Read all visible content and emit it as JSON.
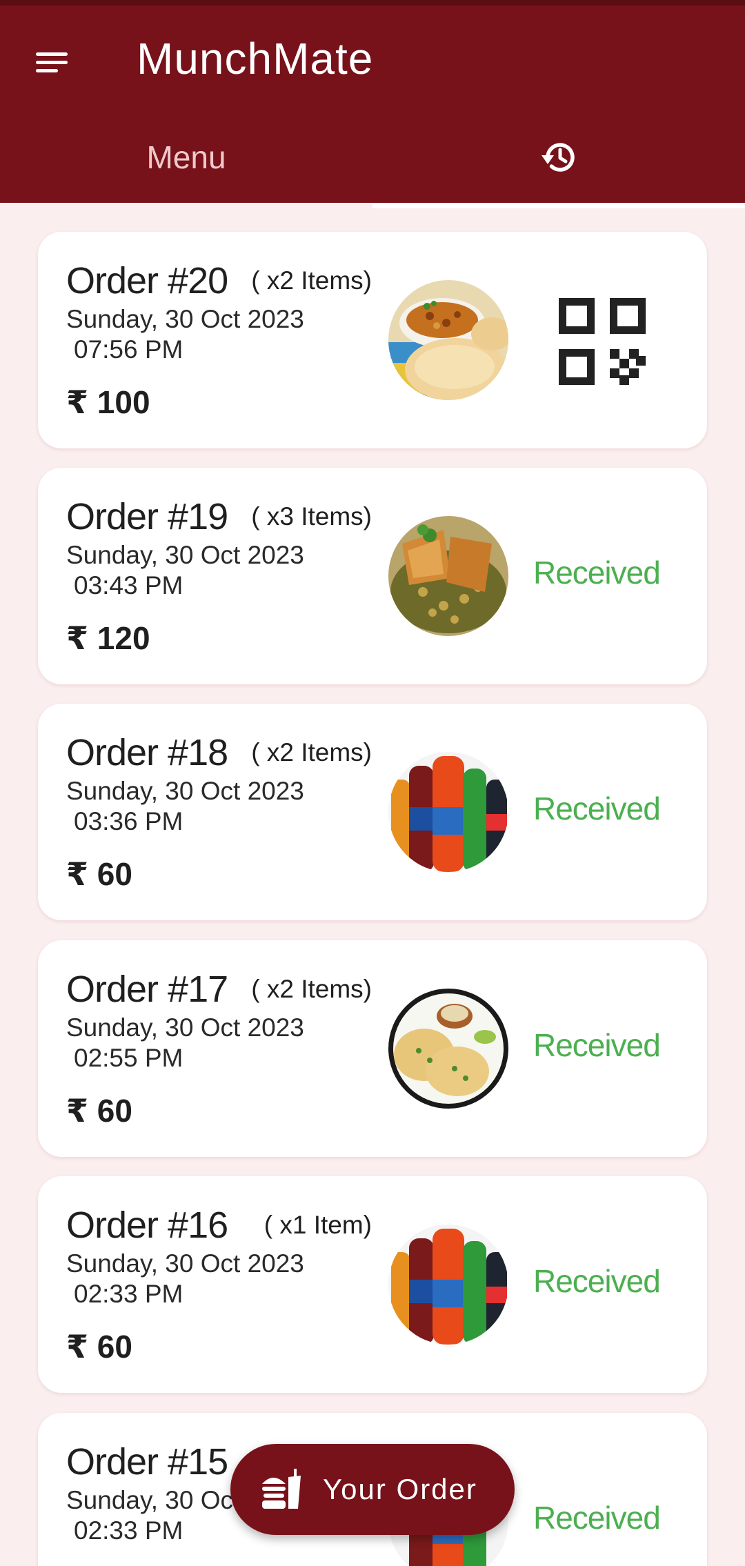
{
  "app": {
    "title": "MunchMate",
    "menu_icon": "hamburger-menu-icon",
    "accent_color": "#78121a",
    "background_color": "#fbeeee",
    "received_color": "#4caf50"
  },
  "tabs": [
    {
      "label": "Menu",
      "icon": null,
      "selected": false
    },
    {
      "label": "",
      "icon": "history-icon",
      "selected": true
    }
  ],
  "orders": [
    {
      "order": "Order #20",
      "items": "( x2 Items)",
      "date": "Sunday, 30 Oct 2023",
      "time": "07:56 PM",
      "total": "₹ 100",
      "thumb": "chole-bhature",
      "status": "",
      "status_icon": "qr-code-icon"
    },
    {
      "order": "Order #19",
      "items": "( x3 Items)",
      "date": "Sunday, 30 Oct 2023",
      "time": "03:43 PM",
      "total": "₹ 120",
      "thumb": "samosa-chole",
      "status": "Received"
    },
    {
      "order": "Order #18",
      "items": "( x2 Items)",
      "date": "Sunday, 30 Oct 2023",
      "time": "03:36 PM",
      "total": "₹ 60",
      "thumb": "soft-drinks",
      "status": "Received"
    },
    {
      "order": "Order #17",
      "items": "( x2 Items)",
      "date": "Sunday, 30 Oct 2023",
      "time": "02:55 PM",
      "total": "₹ 60",
      "thumb": "kulcha-chole",
      "status": "Received"
    },
    {
      "order": "Order #16",
      "items": "( x1 Item)",
      "date": "Sunday, 30 Oct 2023",
      "time": "02:33 PM",
      "total": "₹ 60",
      "thumb": "soft-drinks",
      "status": "Received"
    },
    {
      "order": "Order #15",
      "items": "",
      "date": "Sunday, 30 Oc",
      "time": "02:33 PM",
      "total": "",
      "thumb": "soft-drinks",
      "status": "Received"
    }
  ],
  "fab": {
    "label": "Your Order",
    "icon": "food-order-icon"
  }
}
